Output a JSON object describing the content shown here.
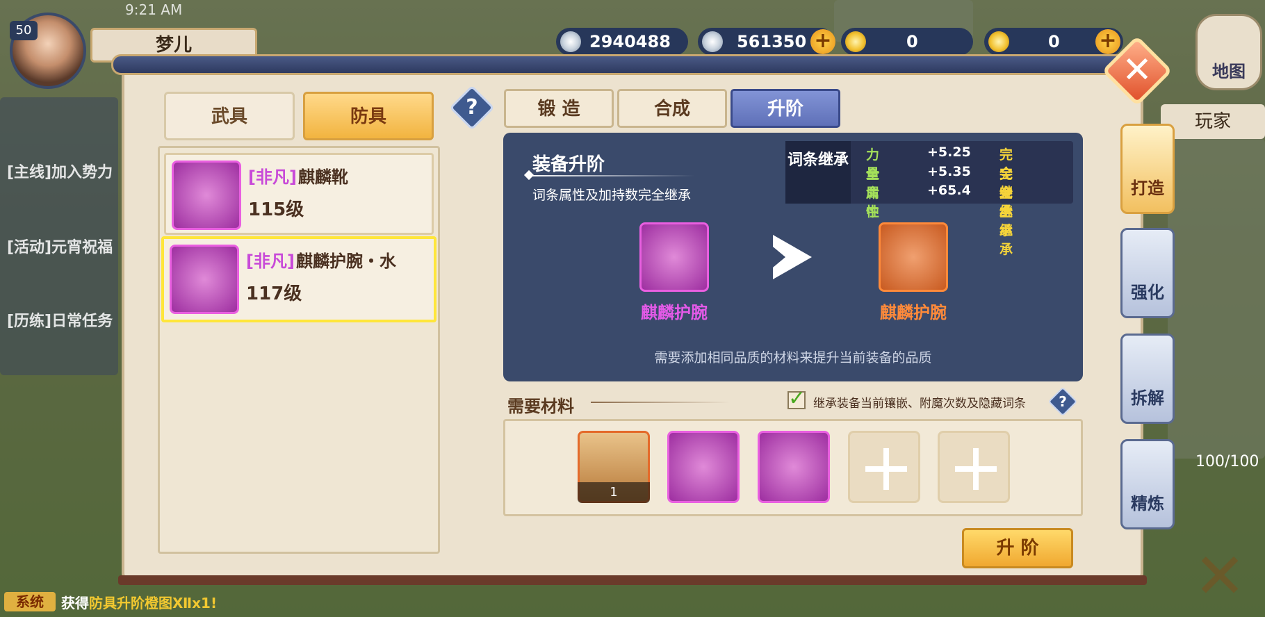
{
  "status_bar": {
    "time": "9:21 AM"
  },
  "player": {
    "level": "50",
    "name": "梦儿"
  },
  "currencies": [
    {
      "value": "2940488",
      "icon": "silver-coin-icon"
    },
    {
      "value": "561350",
      "icon": "silver-coin-icon"
    },
    {
      "value": "0",
      "icon": "gold-coin-icon"
    },
    {
      "value": "0",
      "icon": "gold-coin-icon"
    }
  ],
  "map_button": {
    "label": "地图"
  },
  "side_panel": {
    "players": "玩家",
    "hp": "100/100"
  },
  "left_tabs": {
    "weapon": "武具",
    "armor": "防具"
  },
  "items": [
    {
      "quality": "[非凡]",
      "name": "麒麟靴",
      "level": "115级"
    },
    {
      "quality": "[非凡]",
      "name": "麒麟护腕・水",
      "level": "117级"
    }
  ],
  "right_tabs": {
    "forge": "锻 造",
    "combine": "合成",
    "upgrade": "升阶"
  },
  "upgrade_card": {
    "title": "装备升阶",
    "subtitle": "词条属性及加持数完全继承",
    "stat_label": "词条继承",
    "stats": [
      {
        "name": "力量",
        "value": "+5.25",
        "inherit": "完全继承"
      },
      {
        "name": "全属性",
        "value": "+5.35",
        "inherit": "完全继承"
      },
      {
        "name": "命中",
        "value": "+65.4",
        "inherit": "完全继承"
      }
    ],
    "from_item": "麒麟护腕",
    "to_item": "麒麟护腕",
    "note": "需要添加相同品质的材料来提升当前装备的品质"
  },
  "materials": {
    "title": "需要材料",
    "inherit_option": "继承装备当前镶嵌、附魔次数及隐藏词条",
    "slot1_count": "1"
  },
  "upgrade_button": "升 阶",
  "side_tabs": {
    "forge": "打造",
    "strengthen": "强化",
    "dismantle": "拆解",
    "refine": "精炼"
  },
  "chat": {
    "system_tag": "系统",
    "last_message_prefix": "获得",
    "last_message_item": "防具升阶橙图Ⅻx1!"
  },
  "colors": {
    "accent_gold": "#f2b440",
    "panel_dark": "#3a4a6b",
    "quality_purple": "#c84ad8",
    "quality_orange": "#ff8a3a"
  }
}
